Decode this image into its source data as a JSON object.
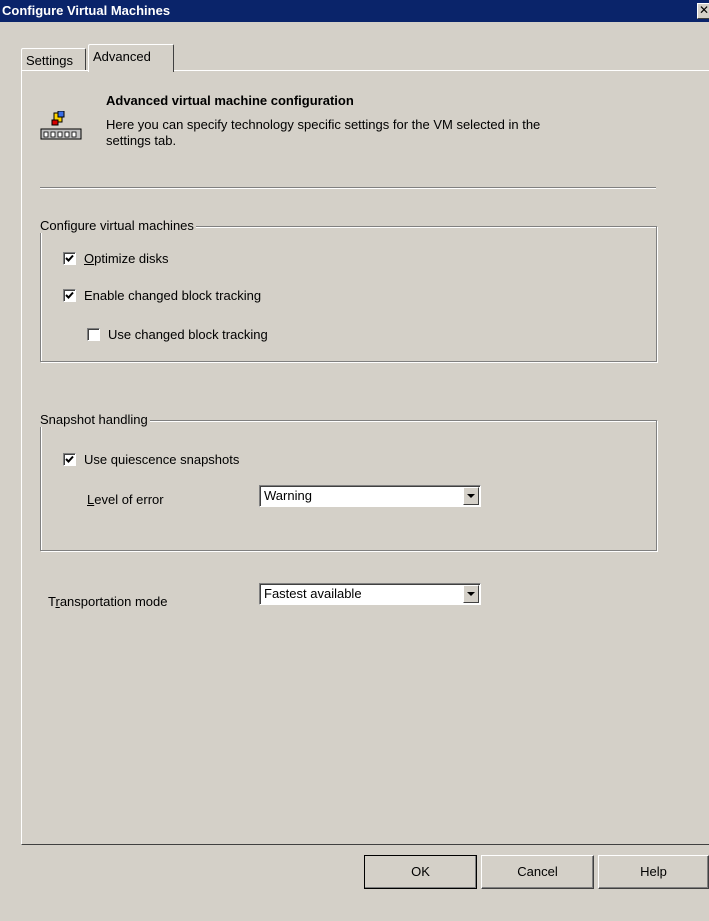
{
  "window": {
    "title": "Configure Virtual Machines",
    "close_glyph": "✕"
  },
  "tabs": [
    {
      "label": "Settings",
      "active": false
    },
    {
      "label": "Advanced",
      "active": true
    }
  ],
  "header": {
    "title": "Advanced virtual machine configuration",
    "description": "Here you can specify technology specific settings for the VM selected in the settings tab.",
    "icon": "server-config-icon"
  },
  "configure_group": {
    "legend": "Configure virtual machines",
    "optimize_disks": {
      "label_prefix": "",
      "accel": "O",
      "label_rest": "ptimize disks",
      "checked": true
    },
    "enable_cbt": {
      "label": "Enable changed block tracking",
      "checked": true
    },
    "use_cbt": {
      "label": "Use changed block tracking",
      "checked": false
    }
  },
  "snapshot_group": {
    "legend": "Snapshot handling",
    "use_quiescence": {
      "label": "Use quiescence snapshots",
      "checked": true
    },
    "level_of_error": {
      "accel": "L",
      "label_rest": "evel of error",
      "value": "Warning"
    }
  },
  "transport": {
    "label_prefix": "T",
    "accel": "r",
    "label_rest": "ansportation mode",
    "value": "Fastest available"
  },
  "buttons": {
    "ok": "OK",
    "cancel": "Cancel",
    "help": "Help"
  },
  "colors": {
    "titlebar": "#0a246a",
    "face": "#d4d0c8"
  }
}
